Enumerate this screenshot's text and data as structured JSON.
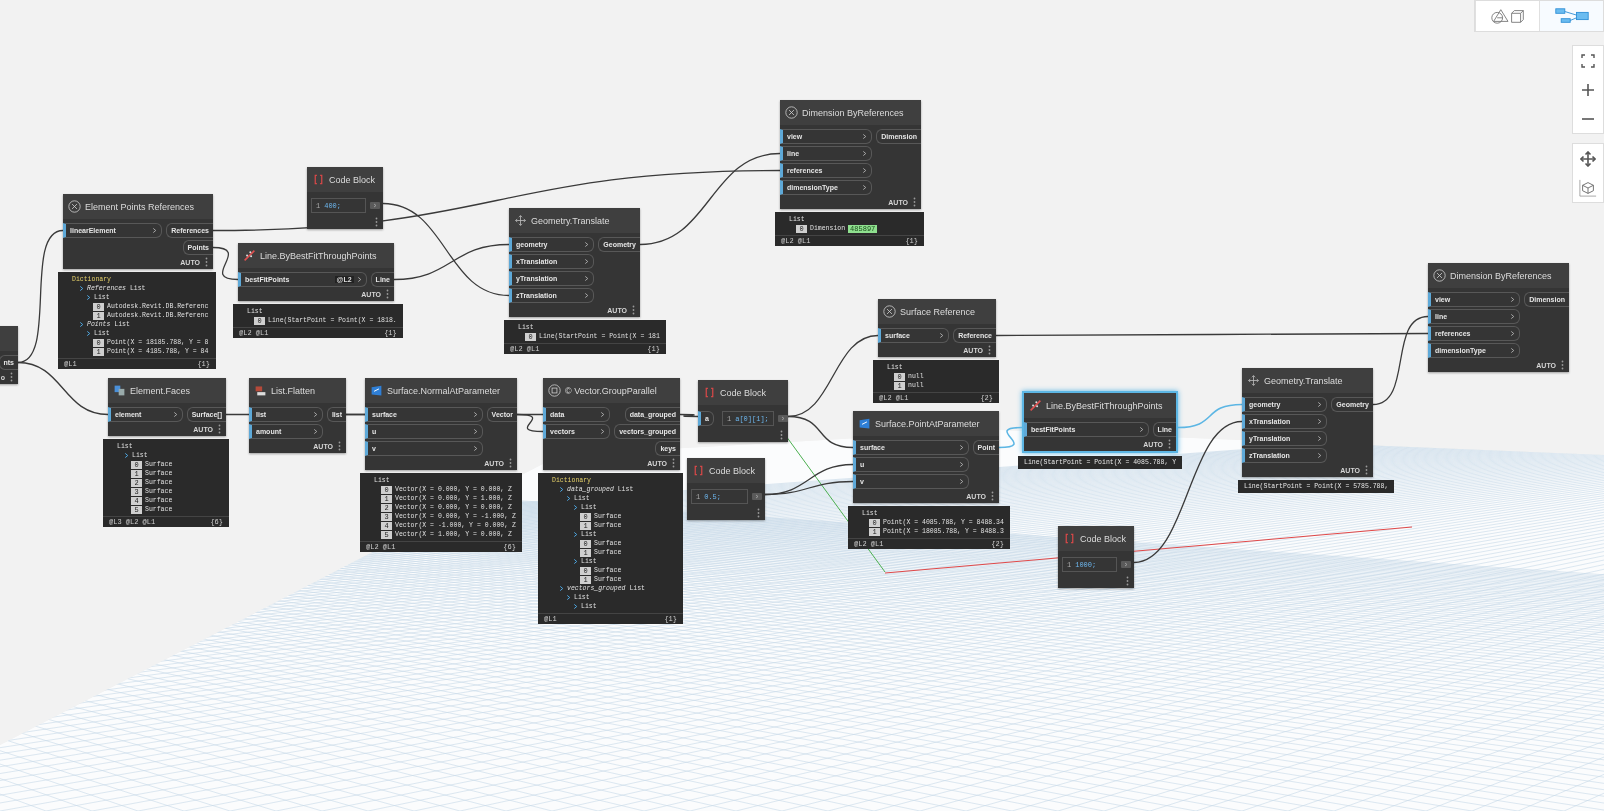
{
  "view_toggle": [
    {
      "kind": "geometry",
      "selected": false
    },
    {
      "kind": "graph",
      "selected": true
    }
  ],
  "nodes": [
    {
      "kind": "partial",
      "selected": false,
      "outputs": [
        {
          "label": "nts"
        }
      ],
      "lacing": "o"
    },
    {
      "kind": "node",
      "title": "Element Points References",
      "selected": false,
      "inputs": [
        {
          "label": "linearElement"
        }
      ],
      "outputs": [
        {
          "label": "References"
        },
        {
          "label": "Points"
        }
      ],
      "lacing": "AUTO",
      "preview": {
        "kind": "tree",
        "items": [
          {
            "kind": "dictionary",
            "label": "Dictionary",
            "children": [
              {
                "kind": "key",
                "label": "*References* List",
                "children": [
                  {
                    "kind": "list",
                    "label": "List",
                    "children": [
                      {
                        "kind": "value",
                        "index": "0",
                        "label": "Autodesk.Revit.DB.Referenc"
                      },
                      {
                        "kind": "value",
                        "index": "1",
                        "label": "Autodesk.Revit.DB.Referenc"
                      }
                    ]
                  }
                ]
              },
              {
                "kind": "key",
                "label": "*Points* List",
                "children": [
                  {
                    "kind": "list",
                    "label": "List",
                    "children": [
                      {
                        "kind": "value",
                        "index": "0",
                        "label": "Point(X = 18185.788, Y = 8"
                      },
                      {
                        "kind": "value",
                        "index": "1",
                        "label": "Point(X = 4185.788, Y = 84"
                      }
                    ]
                  }
                ]
              }
            ]
          }
        ],
        "levels": "@L1",
        "count": "{1}"
      }
    },
    {
      "kind": "code",
      "title": "Code Block",
      "selected": false,
      "line_number": "1",
      "code": "400;"
    },
    {
      "kind": "node",
      "title": "Line.ByBestFitThroughPoints",
      "selected": false,
      "inputs": [
        {
          "label": "bestFitPoints",
          "badge": "@L2"
        }
      ],
      "outputs": [
        {
          "label": "Line"
        }
      ],
      "lacing": "AUTO",
      "preview": {
        "kind": "tree",
        "items": [
          {
            "kind": "list",
            "label": "List",
            "children": [
              {
                "kind": "value",
                "index": "0",
                "label": "Line(StartPoint = Point(X = 1818."
              }
            ]
          }
        ],
        "levels": "@L2 @L1",
        "count": "{1}"
      }
    },
    {
      "kind": "node",
      "title": "Geometry.Translate",
      "selected": false,
      "inputs": [
        {
          "label": "geometry"
        },
        {
          "label": "xTranslation"
        },
        {
          "label": "yTranslation"
        },
        {
          "label": "zTranslation"
        }
      ],
      "outputs": [
        {
          "label": "Geometry"
        }
      ],
      "lacing": "AUTO",
      "preview": {
        "kind": "tree",
        "items": [
          {
            "kind": "list",
            "label": "List",
            "children": [
              {
                "kind": "value",
                "index": "0",
                "label": "Line(StartPoint = Point(X = 181"
              }
            ]
          }
        ],
        "levels": "@L2 @L1",
        "count": "{1}"
      }
    },
    {
      "kind": "node",
      "title": "Dimension ByReferences",
      "selected": false,
      "inputs": [
        {
          "label": "view"
        },
        {
          "label": "line"
        },
        {
          "label": "references"
        },
        {
          "label": "dimensionType"
        }
      ],
      "outputs": [
        {
          "label": "Dimension"
        }
      ],
      "lacing": "AUTO",
      "preview": {
        "kind": "tree",
        "items": [
          {
            "kind": "list",
            "label": "List",
            "children": [
              {
                "kind": "value",
                "index": "0",
                "label": "Dimension",
                "tag": "485897"
              }
            ]
          }
        ],
        "levels": "@L2 @L1",
        "count": "{1}"
      }
    },
    {
      "kind": "node",
      "title": "Element.Faces",
      "selected": false,
      "inputs": [
        {
          "label": "element"
        }
      ],
      "outputs": [
        {
          "label": "Surface[]"
        }
      ],
      "lacing": "AUTO",
      "preview": {
        "kind": "tree",
        "items": [
          {
            "kind": "list",
            "label": "List",
            "children": [
              {
                "kind": "list",
                "label": "List",
                "children": [
                  {
                    "kind": "value",
                    "index": "0",
                    "label": "Surface"
                  },
                  {
                    "kind": "value",
                    "index": "1",
                    "label": "Surface"
                  },
                  {
                    "kind": "value",
                    "index": "2",
                    "label": "Surface"
                  },
                  {
                    "kind": "value",
                    "index": "3",
                    "label": "Surface"
                  },
                  {
                    "kind": "value",
                    "index": "4",
                    "label": "Surface"
                  },
                  {
                    "kind": "value",
                    "index": "5",
                    "label": "Surface"
                  }
                ]
              }
            ]
          }
        ],
        "levels": "@L3 @L2 @L1",
        "count": "{6}"
      }
    },
    {
      "kind": "node",
      "title": "List.Flatten",
      "selected": false,
      "inputs": [
        {
          "label": "list"
        },
        {
          "label": "amount"
        }
      ],
      "outputs": [
        {
          "label": "list"
        }
      ],
      "lacing": "AUTO"
    },
    {
      "kind": "node",
      "title": "Surface.NormalAtParameter",
      "selected": false,
      "inputs": [
        {
          "label": "surface"
        },
        {
          "label": "u"
        },
        {
          "label": "v"
        }
      ],
      "outputs": [
        {
          "label": "Vector"
        }
      ],
      "lacing": "AUTO",
      "preview": {
        "kind": "tree",
        "items": [
          {
            "kind": "list",
            "label": "List",
            "children": [
              {
                "kind": "value",
                "index": "0",
                "label": "Vector(X = 0.000, Y = 0.000, Z"
              },
              {
                "kind": "value",
                "index": "1",
                "label": "Vector(X = 0.000, Y = 1.000, Z"
              },
              {
                "kind": "value",
                "index": "2",
                "label": "Vector(X = 0.000, Y = 0.000, Z"
              },
              {
                "kind": "value",
                "index": "3",
                "label": "Vector(X = 0.000, Y = -1.000, Z"
              },
              {
                "kind": "value",
                "index": "4",
                "label": "Vector(X = -1.000, Y = 0.000, Z"
              },
              {
                "kind": "value",
                "index": "5",
                "label": "Vector(X = 1.000, Y = 0.000, Z"
              }
            ]
          }
        ],
        "levels": "@L2 @L1",
        "count": "{6}"
      }
    },
    {
      "kind": "node",
      "title": "© Vector.GroupParallel",
      "selected": false,
      "inputs": [
        {
          "label": "data"
        },
        {
          "label": "vectors"
        }
      ],
      "outputs": [
        {
          "label": "data_grouped"
        },
        {
          "label": "vectors_grouped"
        },
        {
          "label": "keys"
        }
      ],
      "lacing": "AUTO",
      "preview": {
        "kind": "tree",
        "items": [
          {
            "kind": "dictionary",
            "label": "Dictionary",
            "children": [
              {
                "kind": "key",
                "label": "*data_grouped* List",
                "children": [
                  {
                    "kind": "list",
                    "label": "List",
                    "children": [
                      {
                        "kind": "list",
                        "label": "List",
                        "children": [
                          {
                            "kind": "value",
                            "index": "0",
                            "label": "Surface"
                          },
                          {
                            "kind": "value",
                            "index": "1",
                            "label": "Surface"
                          }
                        ]
                      },
                      {
                        "kind": "list",
                        "label": "List",
                        "children": [
                          {
                            "kind": "value",
                            "index": "0",
                            "label": "Surface"
                          },
                          {
                            "kind": "value",
                            "index": "1",
                            "label": "Surface"
                          }
                        ]
                      },
                      {
                        "kind": "list",
                        "label": "List",
                        "children": [
                          {
                            "kind": "value",
                            "index": "0",
                            "label": "Surface"
                          },
                          {
                            "kind": "value",
                            "index": "1",
                            "label": "Surface"
                          }
                        ]
                      }
                    ]
                  }
                ]
              },
              {
                "kind": "key",
                "label": "*vectors_grouped* List",
                "children": [
                  {
                    "kind": "list",
                    "label": "List",
                    "children": [
                      {
                        "kind": "list",
                        "label": "List"
                      }
                    ]
                  }
                ]
              }
            ]
          }
        ],
        "levels": "@L1",
        "count": "{1}"
      }
    },
    {
      "kind": "code",
      "title": "Code Block",
      "selected": false,
      "inputs": [
        {
          "label": "a"
        }
      ],
      "line_number": "1",
      "code": "a[0][1];"
    },
    {
      "kind": "code",
      "title": "Code Block",
      "selected": false,
      "line_number": "1",
      "code": "0.5;"
    },
    {
      "kind": "node",
      "title": "Surface Reference",
      "selected": false,
      "inputs": [
        {
          "label": "surface"
        }
      ],
      "outputs": [
        {
          "label": "Reference"
        }
      ],
      "lacing": "AUTO",
      "preview": {
        "kind": "tree",
        "items": [
          {
            "kind": "list",
            "label": "List",
            "children": [
              {
                "kind": "value",
                "index": "0",
                "label": "null"
              },
              {
                "kind": "value",
                "index": "1",
                "label": "null"
              }
            ]
          }
        ],
        "levels": "@L2 @L1",
        "count": "{2}"
      }
    },
    {
      "kind": "node",
      "title": "Surface.PointAtParameter",
      "selected": false,
      "inputs": [
        {
          "label": "surface"
        },
        {
          "label": "u"
        },
        {
          "label": "v"
        }
      ],
      "outputs": [
        {
          "label": "Point"
        }
      ],
      "lacing": "AUTO",
      "preview": {
        "kind": "tree",
        "items": [
          {
            "kind": "list",
            "label": "List",
            "children": [
              {
                "kind": "value",
                "index": "0",
                "label": "Point(X = 4085.788, Y = 8488.34"
              },
              {
                "kind": "value",
                "index": "1",
                "label": "Point(X = 18085.788, Y = 8488.3"
              }
            ]
          }
        ],
        "levels": "@L2 @L1",
        "count": "{2}"
      }
    },
    {
      "kind": "node",
      "title": "Line.ByBestFitThroughPoints",
      "selected": true,
      "inputs": [
        {
          "label": "bestFitPoints"
        }
      ],
      "outputs": [
        {
          "label": "Line"
        }
      ],
      "lacing": "AUTO",
      "preview": {
        "kind": "compact",
        "text": "Line(StartPoint = Point(X = 4085.788, Y"
      }
    },
    {
      "kind": "node",
      "title": "Geometry.Translate",
      "selected": false,
      "inputs": [
        {
          "label": "geometry"
        },
        {
          "label": "xTranslation"
        },
        {
          "label": "yTranslation"
        },
        {
          "label": "zTranslation"
        }
      ],
      "outputs": [
        {
          "label": "Geometry"
        }
      ],
      "lacing": "AUTO",
      "preview": {
        "kind": "compact",
        "text": "Line(StartPoint = Point(X = 5785.788,"
      }
    },
    {
      "kind": "node",
      "title": "Dimension ByReferences",
      "selected": false,
      "inputs": [
        {
          "label": "view"
        },
        {
          "label": "line"
        },
        {
          "label": "references"
        },
        {
          "label": "dimensionType"
        }
      ],
      "outputs": [
        {
          "label": "Dimension"
        }
      ],
      "lacing": "AUTO"
    },
    {
      "kind": "code",
      "title": "Code Block",
      "selected": false,
      "line_number": "1",
      "code": "1000;"
    }
  ]
}
